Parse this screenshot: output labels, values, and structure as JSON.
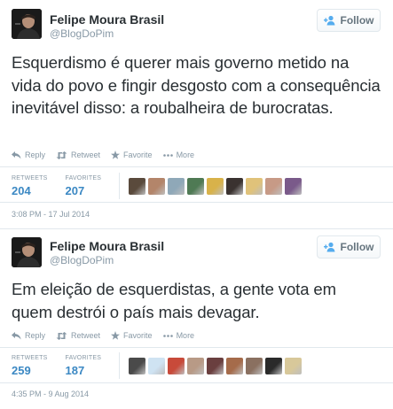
{
  "tweets": [
    {
      "user": {
        "name": "Felipe Moura Brasil",
        "handle": "@BlogDoPim"
      },
      "follow_label": "Follow",
      "text": "Esquerdismo é querer mais governo metido na vida do povo e fingir desgosto com a consequência inevitável disso: a roubalheira de burocratas.",
      "actions": {
        "reply": "Reply",
        "retweet": "Retweet",
        "favorite": "Favorite",
        "more": "More"
      },
      "stats": {
        "retweets_label": "RETWEETS",
        "retweets": "204",
        "favorites_label": "FAVORITES",
        "favorites": "207"
      },
      "timestamp": "3:08 PM - 17 Jul 2014",
      "faver_colors": [
        "#5a4a3c",
        "#b3856a",
        "#8fa8b8",
        "#4f7a54",
        "#d8b24a",
        "#3a3230",
        "#e0c27a",
        "#c79a86",
        "#7a5a8a"
      ]
    },
    {
      "user": {
        "name": "Felipe Moura Brasil",
        "handle": "@BlogDoPim"
      },
      "follow_label": "Follow",
      "text": "Em eleição de esquerdistas, a gente vota em quem destrói o país mais devagar.",
      "actions": {
        "reply": "Reply",
        "retweet": "Retweet",
        "favorite": "Favorite",
        "more": "More"
      },
      "stats": {
        "retweets_label": "RETWEETS",
        "retweets": "259",
        "favorites_label": "FAVORITES",
        "favorites": "187"
      },
      "timestamp": "4:35 PM - 9 Aug 2014",
      "faver_colors": [
        "#4a4a4a",
        "#cfe3f2",
        "#c84a3a",
        "#b89a86",
        "#6a3f3f",
        "#a56b4a",
        "#8a7060",
        "#2a2a2a",
        "#d8c89a"
      ]
    }
  ]
}
